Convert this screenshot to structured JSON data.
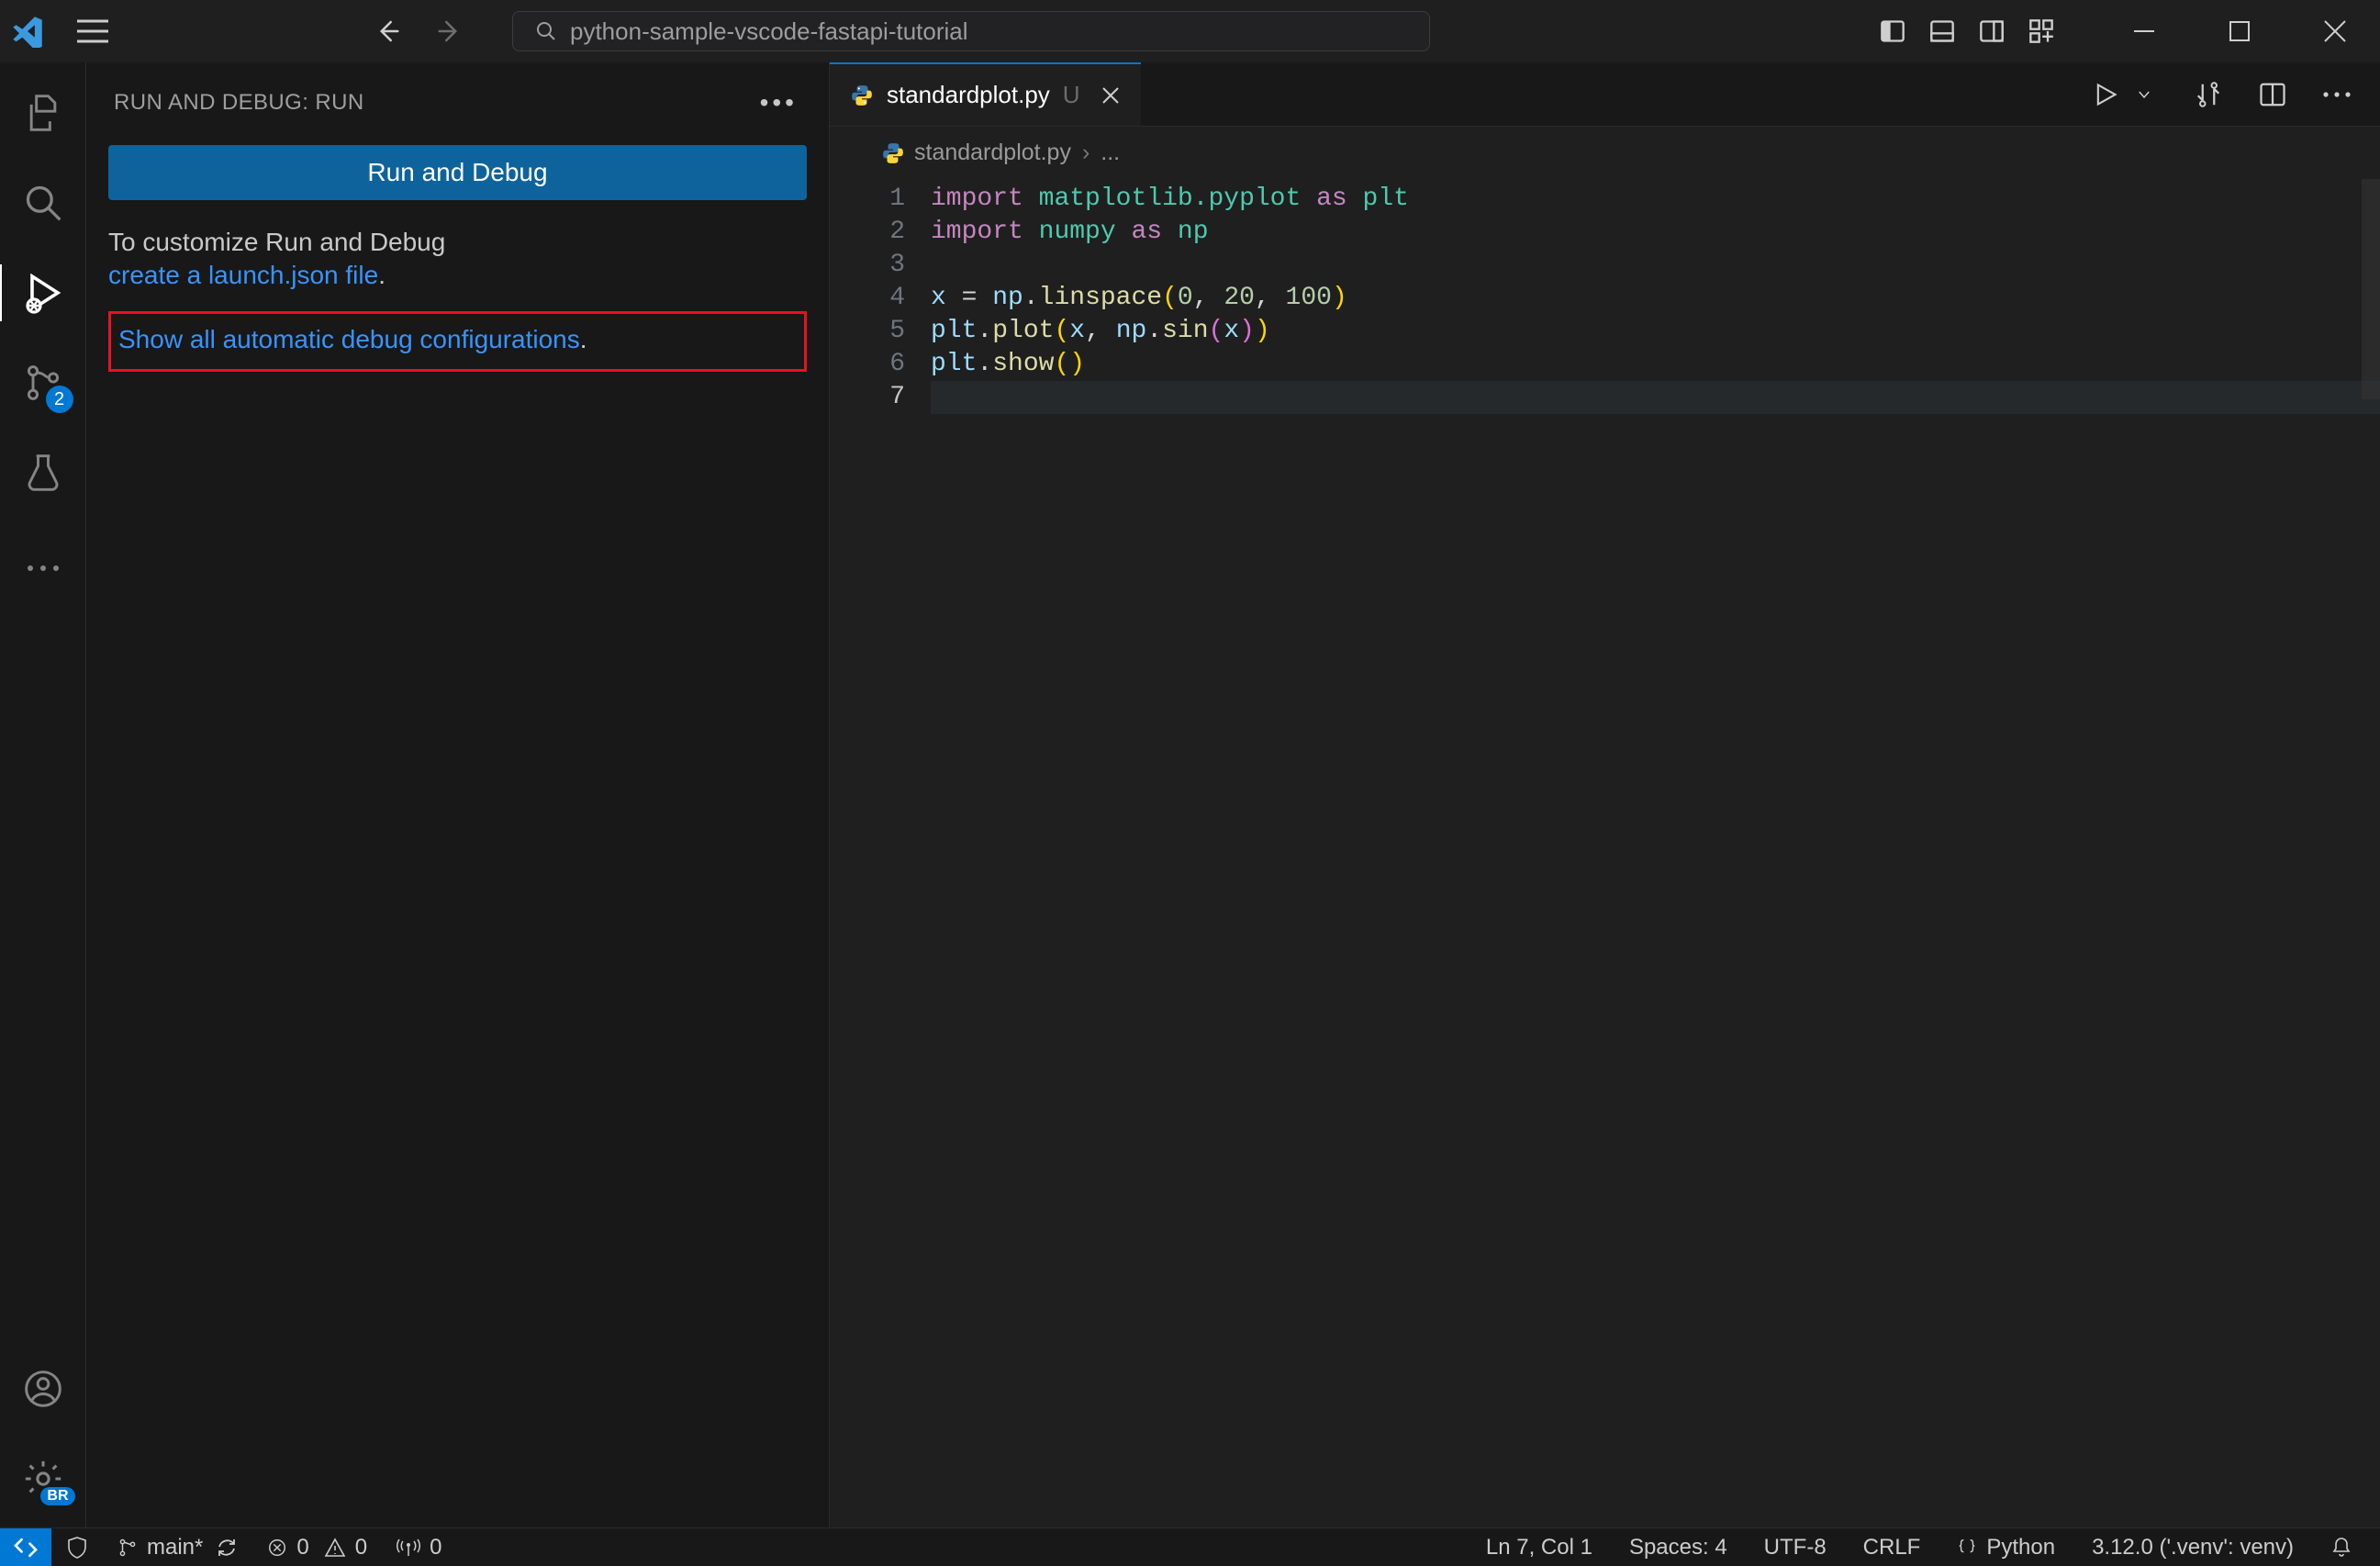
{
  "title_bar": {
    "command_center": "python-sample-vscode-fastapi-tutorial"
  },
  "activity": {
    "scm_badge": "2",
    "settings_badge": "BR"
  },
  "sidebar": {
    "header": "RUN AND DEBUG: RUN",
    "run_button": "Run and Debug",
    "customize_text": "To customize Run and Debug ",
    "create_launch_link": "create a launch.json file",
    "period": ".",
    "show_all_link": "Show all automatic debug configurations",
    "show_all_period": "."
  },
  "editor": {
    "tab": {
      "name": "standardplot.py",
      "modified": "U"
    },
    "breadcrumb": {
      "file": "standardplot.py",
      "more": "..."
    },
    "gutter": [
      "1",
      "2",
      "3",
      "4",
      "5",
      "6",
      "7"
    ],
    "code": {
      "l1": {
        "kw1": "import",
        "mod": "matplotlib.pyplot",
        "kw2": "as",
        "alias": "plt"
      },
      "l2": {
        "kw1": "import",
        "mod": "numpy",
        "kw2": "as",
        "alias": "np"
      },
      "l4": {
        "var": "x",
        "eq": "=",
        "obj": "np",
        "fn": "linspace",
        "a": "0",
        "b": "20",
        "c": "100"
      },
      "l5": {
        "obj": "plt",
        "fn": "plot",
        "arg1": "x",
        "obj2": "np",
        "fn2": "sin",
        "arg2": "x"
      },
      "l6": {
        "obj": "plt",
        "fn": "show"
      }
    }
  },
  "status": {
    "branch": "main*",
    "errors": "0",
    "warnings": "0",
    "ports": "0",
    "cursor": "Ln 7, Col 1",
    "spaces": "Spaces: 4",
    "encoding": "UTF-8",
    "eol": "CRLF",
    "lang": "Python",
    "interpreter": "3.12.0 ('.venv': venv)"
  }
}
